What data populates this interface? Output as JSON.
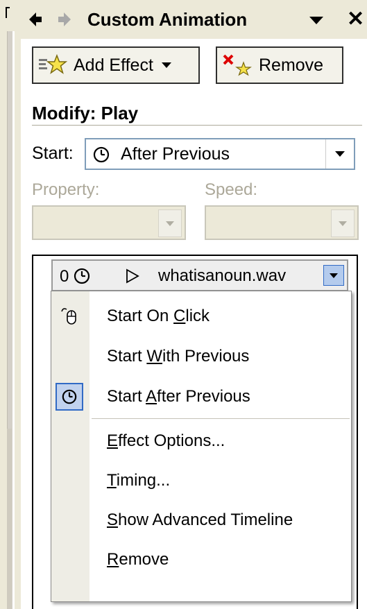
{
  "panel": {
    "title": "Custom Animation",
    "close_glyph": "✕"
  },
  "toolbar": {
    "add_effect_label": "Add Effect",
    "remove_label": "Remove"
  },
  "modify": {
    "heading": "Modify: Play",
    "start_label": "Start:",
    "start_value": "After Previous",
    "property_label": "Property:",
    "property_value": "",
    "speed_label": "Speed:",
    "speed_value": ""
  },
  "effect_list": {
    "items": [
      {
        "order": "0",
        "name": "whatisanoun.wav",
        "trigger_icon": "clock-icon",
        "effect_icon": "play-icon"
      }
    ]
  },
  "context_menu": {
    "items": [
      {
        "label": "Start On Click",
        "access_key": "C",
        "icon": "mouse-icon",
        "checked": false
      },
      {
        "label": "Start With Previous",
        "access_key": "W",
        "icon": "",
        "checked": false
      },
      {
        "label": "Start After Previous",
        "access_key": "A",
        "icon": "clock-icon",
        "checked": true
      },
      {
        "label": "Effect Options...",
        "access_key": "E",
        "icon": "",
        "checked": false
      },
      {
        "label": "Timing...",
        "access_key": "T",
        "icon": "",
        "checked": false
      },
      {
        "label": "Show Advanced Timeline",
        "access_key": "S",
        "icon": "",
        "checked": false
      },
      {
        "label": "Remove",
        "access_key": "R",
        "icon": "",
        "checked": false
      }
    ]
  },
  "colors": {
    "chrome": "#ece9d8",
    "highlight_border": "#316ac5",
    "highlight_fill": "#c1d2ee",
    "disabled_text": "#aca899"
  }
}
